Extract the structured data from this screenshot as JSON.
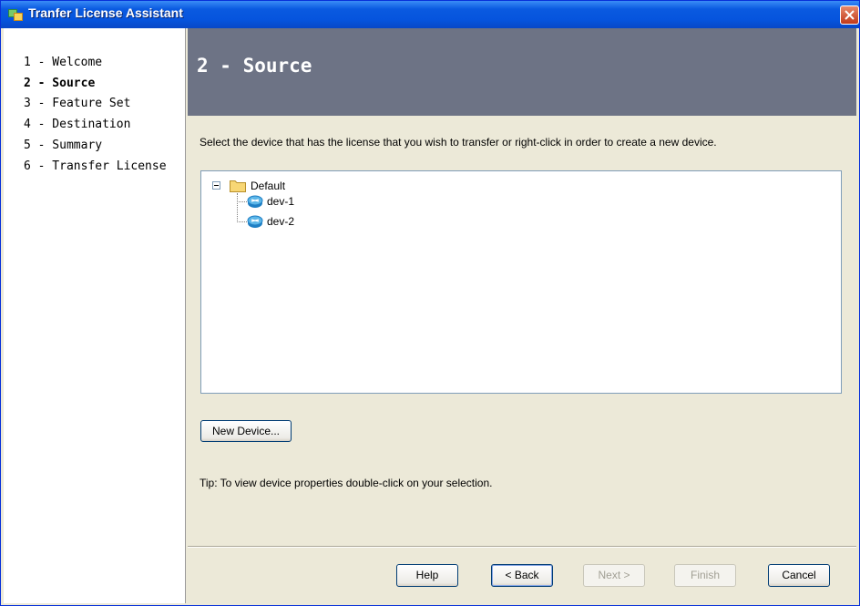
{
  "window": {
    "title": "Tranfer License Assistant",
    "icons": {
      "app": "wizard-app-icon",
      "close": "close-icon"
    }
  },
  "steps": [
    {
      "label": "1 - Welcome",
      "active": false
    },
    {
      "label": "2 - Source",
      "active": true
    },
    {
      "label": "3 - Feature Set",
      "active": false
    },
    {
      "label": "4 - Destination",
      "active": false
    },
    {
      "label": "5 - Summary",
      "active": false
    },
    {
      "label": "6 - Transfer License",
      "active": false
    }
  ],
  "page": {
    "header_title": "2 - Source",
    "instruction": "Select the device that has the license that you wish to transfer or right-click in order to create a new device.",
    "tip": "Tip: To view device properties double-click on your selection."
  },
  "tree": {
    "root": {
      "label": "Default",
      "expanded": true,
      "icon": "folder-icon"
    },
    "children": [
      {
        "label": "dev-1",
        "icon": "router-device-icon"
      },
      {
        "label": "dev-2",
        "icon": "router-device-icon"
      }
    ]
  },
  "buttons": {
    "new_device": "New Device...",
    "help": "Help",
    "back": "< Back",
    "next": "Next >",
    "finish": "Finish",
    "cancel": "Cancel"
  },
  "colors": {
    "titlebar": "#0654dd",
    "header_band": "#6d7385",
    "dialog_bg": "#ece9d8"
  }
}
